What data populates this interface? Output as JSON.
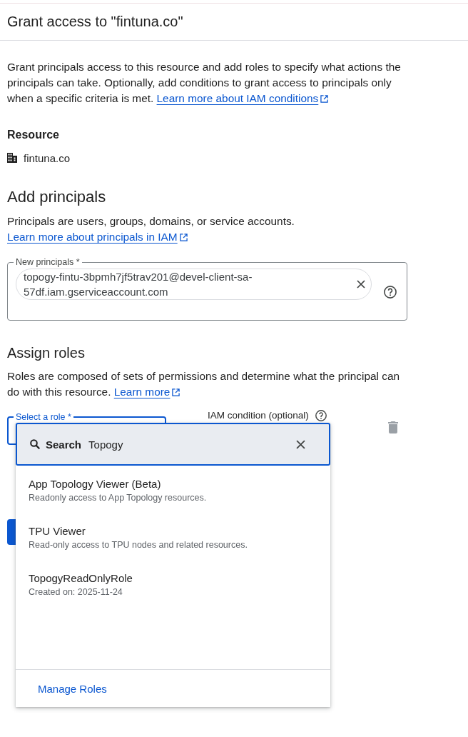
{
  "dialog": {
    "title": "Grant access to \"fintuna.co\""
  },
  "intro": {
    "text": "Grant principals access to this resource and add roles to specify what actions the principals can take. Optionally, add conditions to grant access to principals only when a specific criteria is met.",
    "link": "Learn more about IAM conditions"
  },
  "resource": {
    "heading": "Resource",
    "name": "fintuna.co"
  },
  "add_principals": {
    "heading": "Add principals",
    "description": "Principals are users, groups, domains, or service accounts.",
    "link": "Learn more about principals in IAM",
    "field": {
      "label": "New principals *",
      "chips": [
        "topogy-fintu-3bpmh7jf5trav201@devel-client-sa-57df.iam.gserviceaccount.com"
      ]
    }
  },
  "assign_roles": {
    "heading": "Assign roles",
    "description": "Roles are composed of sets of permissions and determine what the principal can do with this resource.",
    "link": "Learn more",
    "role_field": {
      "label": "Select a role *",
      "focused": true
    },
    "condition": {
      "label": "IAM condition (optional)"
    }
  },
  "role_menu": {
    "search": {
      "label": "Search",
      "value": "Topogy"
    },
    "options": [
      {
        "title": "App Topology Viewer (Beta)",
        "description": "Readonly access to App Topology resources."
      },
      {
        "title": "TPU Viewer",
        "description": "Read-only access to TPU nodes and related resources."
      },
      {
        "title": "TopogyReadOnlyRole",
        "description": "Created on: 2025-11-24"
      }
    ],
    "footer_link": "Manage Roles"
  }
}
